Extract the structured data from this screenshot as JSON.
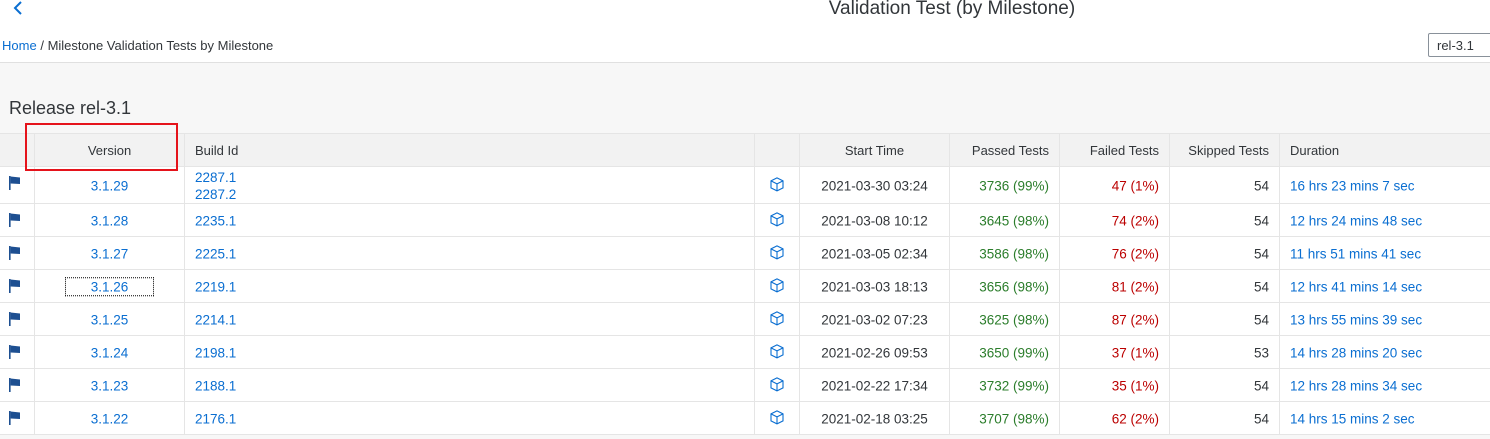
{
  "header": {
    "title": "Validation Test (by Milestone)",
    "back_icon": "chevron-left-icon"
  },
  "breadcrumb": {
    "home": "Home",
    "separator": "/",
    "current": "Milestone Validation Tests by Milestone"
  },
  "release_select": {
    "value": "rel-3.1"
  },
  "section": {
    "title": "Release rel-3.1"
  },
  "table": {
    "columns": {
      "version": "Version",
      "build_id": "Build Id",
      "start_time": "Start Time",
      "passed": "Passed Tests",
      "failed": "Failed Tests",
      "skipped": "Skipped Tests",
      "duration": "Duration"
    },
    "rows": [
      {
        "version": "3.1.29",
        "build1": "2287.1",
        "build2": "2287.2",
        "start": "2021-03-30 03:24",
        "passed": "3736 (99%)",
        "failed": "47 (1%)",
        "skipped": "54",
        "duration": "16 hrs 23 mins 7 sec"
      },
      {
        "version": "3.1.28",
        "build1": "2235.1",
        "start": "2021-03-08 10:12",
        "passed": "3645 (98%)",
        "failed": "74 (2%)",
        "skipped": "54",
        "duration": "12 hrs 24 mins 48 sec"
      },
      {
        "version": "3.1.27",
        "build1": "2225.1",
        "start": "2021-03-05 02:34",
        "passed": "3586 (98%)",
        "failed": "76 (2%)",
        "skipped": "54",
        "duration": "11 hrs 51 mins 41 sec"
      },
      {
        "version": "3.1.26",
        "build1": "2219.1",
        "start": "2021-03-03 18:13",
        "passed": "3656 (98%)",
        "failed": "81 (2%)",
        "skipped": "54",
        "duration": "12 hrs 41 mins 14 sec"
      },
      {
        "version": "3.1.25",
        "build1": "2214.1",
        "start": "2021-03-02 07:23",
        "passed": "3625 (98%)",
        "failed": "87 (2%)",
        "skipped": "54",
        "duration": "13 hrs 55 mins 39 sec"
      },
      {
        "version": "3.1.24",
        "build1": "2198.1",
        "start": "2021-02-26 09:53",
        "passed": "3650 (99%)",
        "failed": "37 (1%)",
        "skipped": "53",
        "duration": "14 hrs 28 mins 20 sec"
      },
      {
        "version": "3.1.23",
        "build1": "2188.1",
        "start": "2021-02-22 17:34",
        "passed": "3732 (99%)",
        "failed": "35 (1%)",
        "skipped": "54",
        "duration": "12 hrs 28 mins 34 sec"
      },
      {
        "version": "3.1.22",
        "build1": "2176.1",
        "start": "2021-02-18 03:25",
        "passed": "3707 (98%)",
        "failed": "62 (2%)",
        "skipped": "54",
        "duration": "14 hrs 15 mins 2 sec"
      }
    ]
  },
  "colors": {
    "link": "#0a6ed1",
    "pass": "#2b7d2b",
    "fail": "#bb0000",
    "flag": "#1d4f91",
    "highlight": "#e5131b"
  },
  "icons": {
    "row_flag": "flag-icon",
    "build_detail": "cube-icon"
  }
}
